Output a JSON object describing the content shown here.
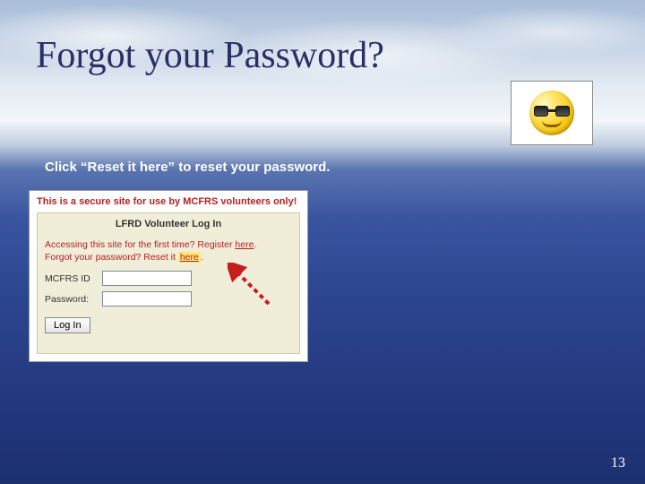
{
  "title": "Forgot your Password?",
  "instruction_prefix": "Click “Reset it ",
  "instruction_bold": "here”",
  "instruction_suffix": " to reset your password.",
  "panel": {
    "secure_note": "This is a secure site for use by MCFRS volunteers only!",
    "header": "LFRD Volunteer Log In",
    "line1_prefix": "Accessing this site for the first time? Register ",
    "line1_link": "here",
    "line1_suffix": ".",
    "line2_prefix": "Forgot your password? Reset it ",
    "line2_link": "here",
    "line2_suffix": ".",
    "id_label": "MCFRS ID",
    "pw_label": "Password:",
    "login_button": "Log In"
  },
  "page_number": "13"
}
